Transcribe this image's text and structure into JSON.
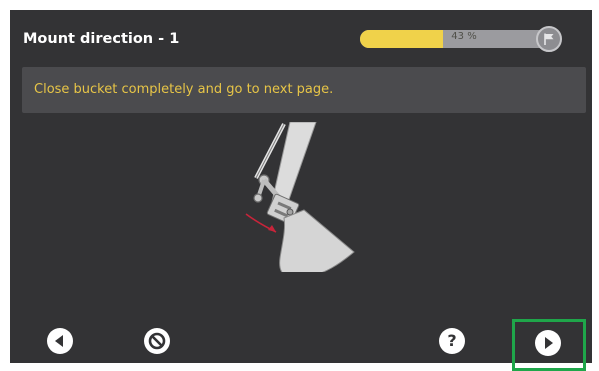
{
  "header": {
    "title": "Mount direction - 1"
  },
  "progress": {
    "percent": 43,
    "label": "43 %"
  },
  "banner": {
    "message": "Close bucket completely and go to next page."
  },
  "footer": {
    "back_icon": "back-arrow-icon",
    "cancel_icon": "cancel-icon",
    "help_icon": "help-icon",
    "help_symbol": "?",
    "next_icon": "next-arrow-icon"
  },
  "colors": {
    "background": "#333335",
    "progress_fill": "#f0d24a",
    "banner_text": "#e7c547",
    "highlight_frame": "#1fa64a",
    "direction_arrow": "#c8243a"
  }
}
